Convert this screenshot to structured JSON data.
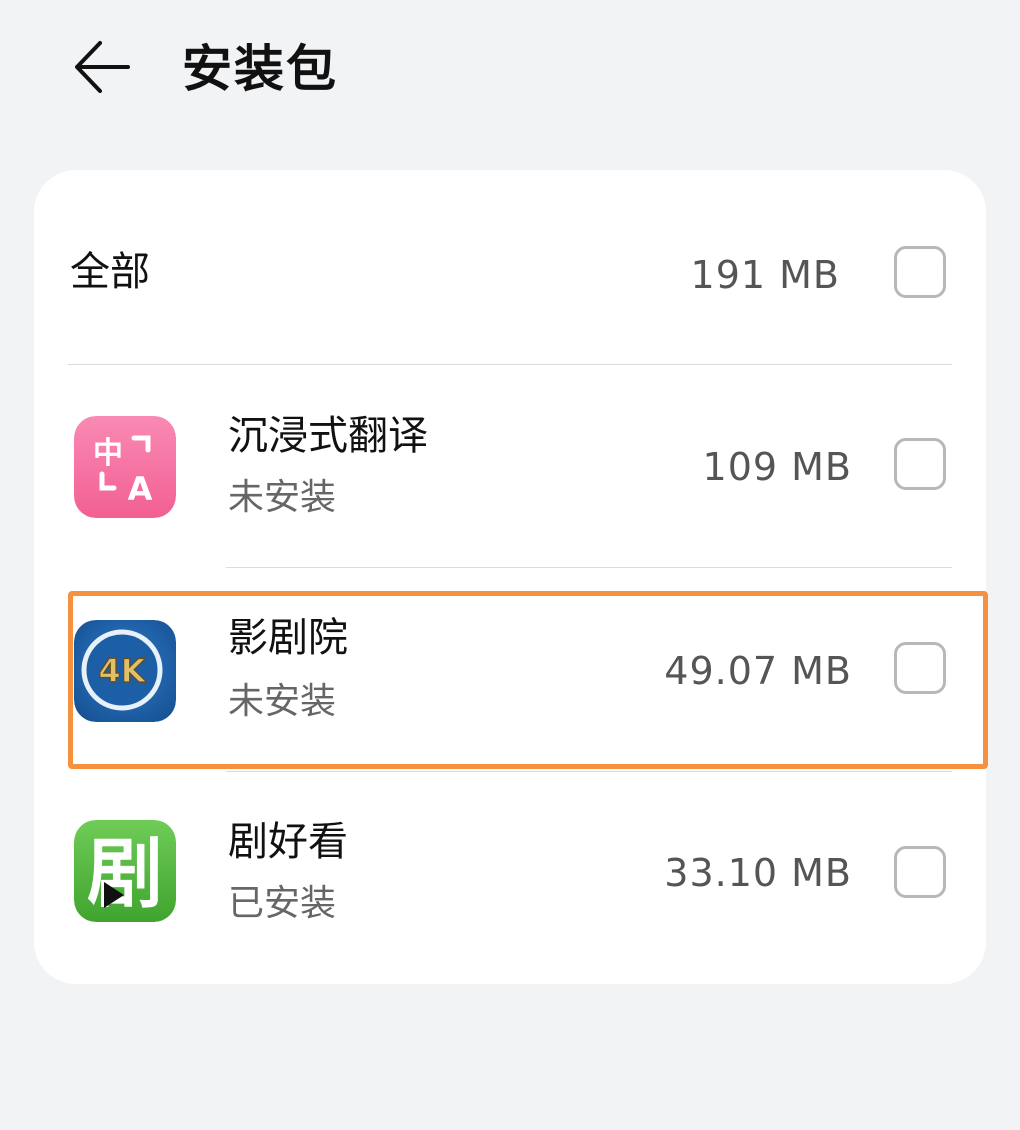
{
  "header": {
    "title": "安装包",
    "back_icon": "arrow-left-icon"
  },
  "summary": {
    "label": "全部",
    "size": "191 MB",
    "checked": false
  },
  "apps": [
    {
      "name": "沉浸式翻译",
      "status": "未安装",
      "size": "109 MB",
      "icon": "translate-app-icon",
      "icon_color": "#f46a9b",
      "checked": false
    },
    {
      "name": "影剧院",
      "status": "未安装",
      "size": "49.07 MB",
      "icon": "4k-cinema-app-icon",
      "icon_color": "#1f5fa8",
      "checked": false,
      "highlighted": true
    },
    {
      "name": "剧好看",
      "status": "已安装",
      "size": "33.10 MB",
      "icon": "drama-app-icon",
      "icon_color": "#4fba3f",
      "checked": false
    }
  ],
  "colors": {
    "background": "#f1f3f5",
    "card": "#ffffff",
    "highlight": "#f5913f"
  }
}
